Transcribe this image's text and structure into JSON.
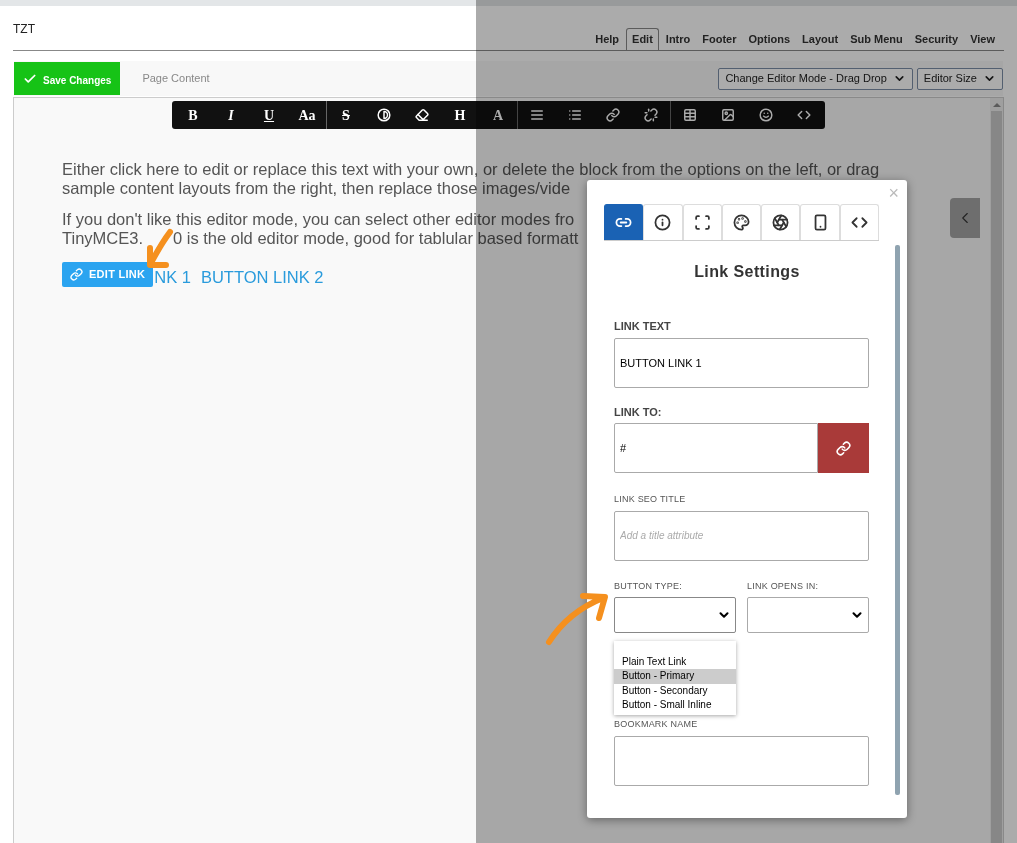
{
  "header": {
    "site": "TZT",
    "tabs": [
      {
        "label": "Help",
        "selected": false
      },
      {
        "label": "Edit",
        "selected": true
      },
      {
        "label": "Intro",
        "selected": false
      },
      {
        "label": "Footer",
        "selected": false
      },
      {
        "label": "Options",
        "selected": false
      },
      {
        "label": "Layout",
        "selected": false
      },
      {
        "label": "Sub Menu",
        "selected": false
      },
      {
        "label": "Security",
        "selected": false
      },
      {
        "label": "View",
        "selected": false
      }
    ]
  },
  "action_row": {
    "save_button": "Save Changes",
    "section_label": "Page Content",
    "selects": [
      "Change Editor Mode - Drag Drop",
      "Editor Size"
    ]
  },
  "toolbar": {
    "letters": [
      "B",
      "I",
      "U",
      "Aa",
      "S",
      "H",
      "A"
    ]
  },
  "editor": {
    "paragraphs": [
      [
        [
          "Either click here to edit or replace this text with your own, or delete the block from the options on the left, or drag"
        ],
        [
          "sample content layouts from the right, then replace those images/vide"
        ]
      ],
      [
        [
          "If you don't like this editor mode, you can select other editor modes fro"
        ],
        [
          "TinyMCE3.",
          "0 is the old editor mode, good for tablular based formatt"
        ]
      ]
    ],
    "edit_link_badge": "EDIT LINK",
    "links": [
      "NK 1",
      "BUTTON LINK 2"
    ]
  },
  "modal": {
    "close": "×",
    "tabs": [
      {
        "selected": true
      },
      {
        "selected": false
      },
      {
        "selected": false
      },
      {
        "selected": false
      },
      {
        "selected": false
      },
      {
        "selected": false
      },
      {
        "selected": false
      }
    ],
    "title": "Link Settings",
    "link_text": {
      "label": "LINK TEXT",
      "value": "BUTTON LINK 1"
    },
    "link_to": {
      "label": "LINK TO:",
      "value": "#"
    },
    "seo_title": {
      "label": "LINK SEO TITLE",
      "placeholder": "Add a title attribute"
    },
    "button_type": {
      "label": "BUTTON TYPE:",
      "expanded": true,
      "options": [
        {
          "label": "Plain Text Link",
          "selected": false
        },
        {
          "label": "Button - Primary",
          "selected": true
        },
        {
          "label": "Button - Secondary",
          "selected": false
        },
        {
          "label": "Button - Small Inline",
          "selected": false
        }
      ]
    },
    "opens_in": {
      "label": "LINK OPENS IN:"
    },
    "bookmark": {
      "label": "BOOKMARK NAME"
    }
  }
}
